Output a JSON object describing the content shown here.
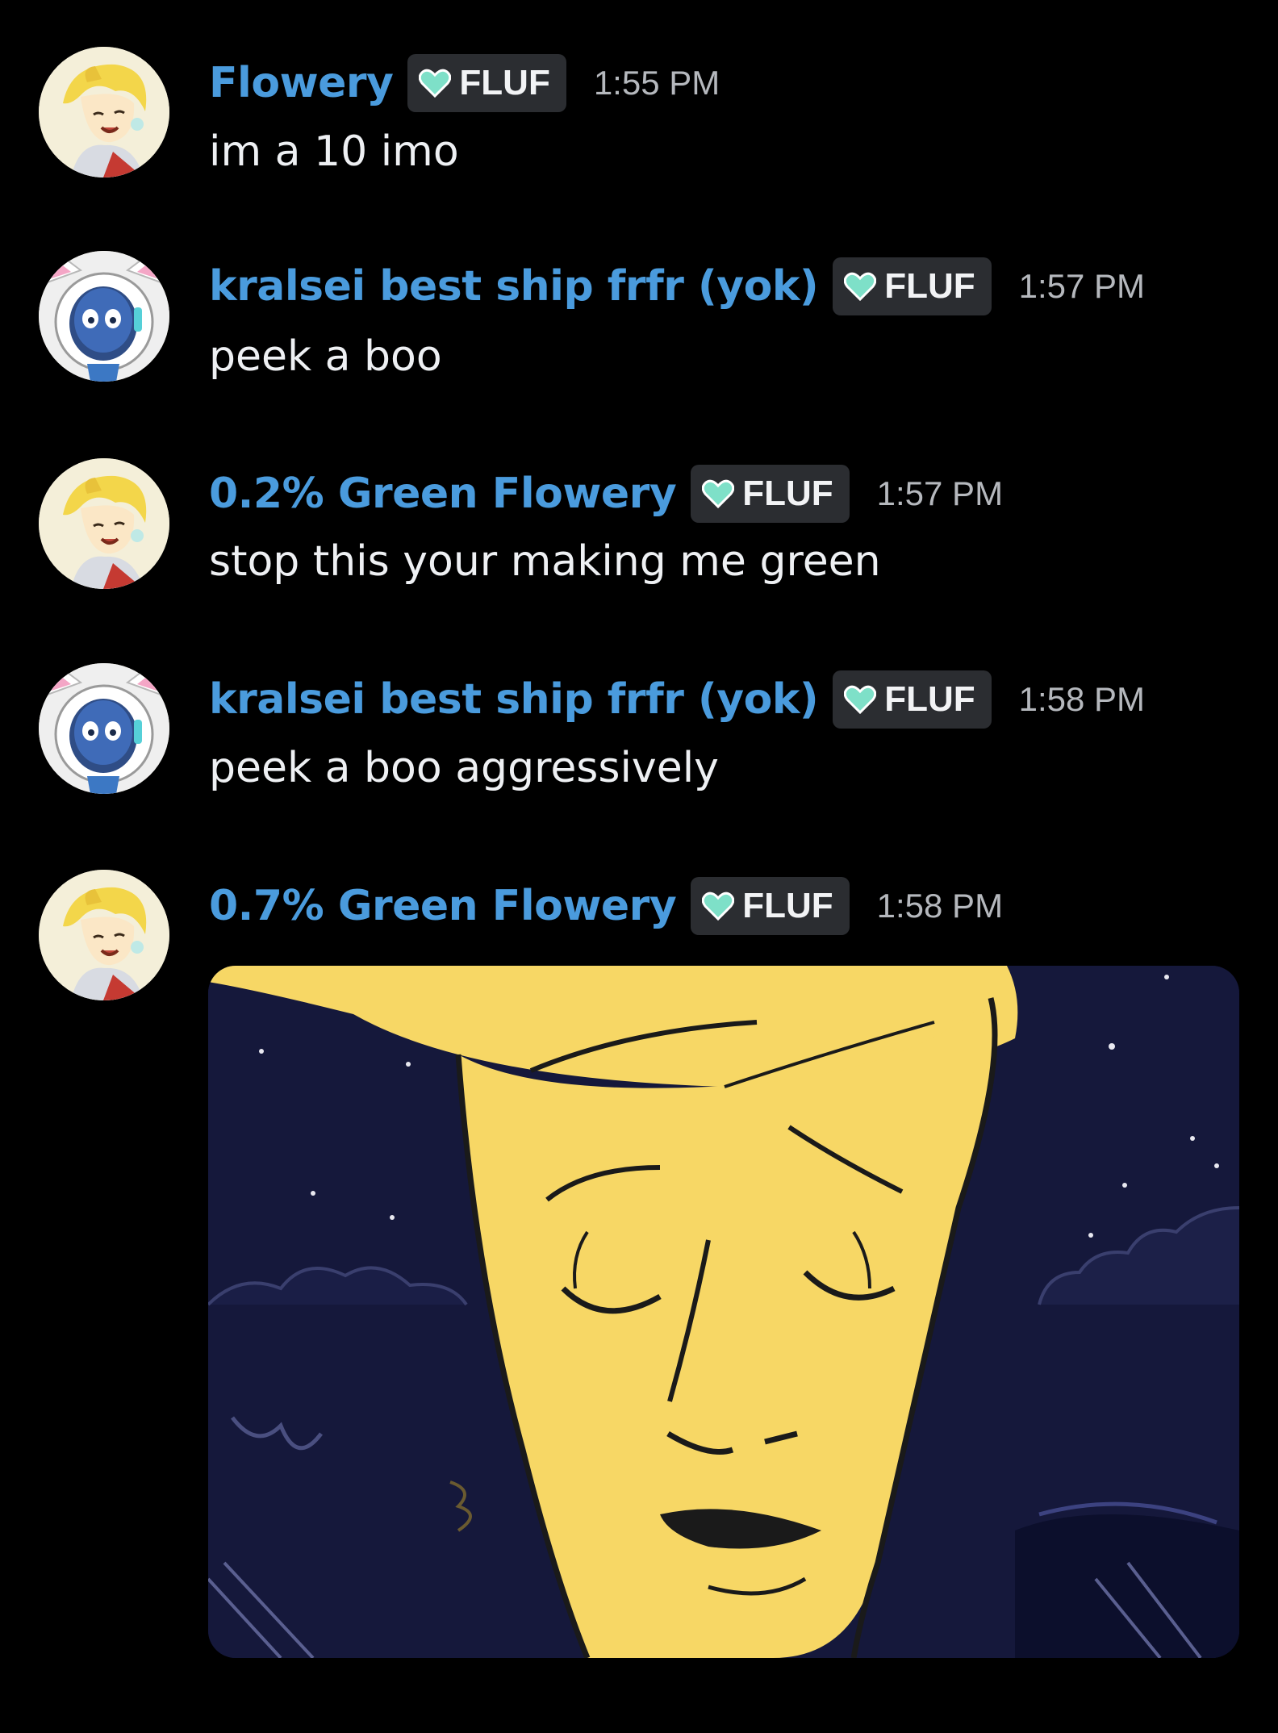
{
  "messages": [
    {
      "username": "Flowery",
      "badge": "FLUF",
      "time": "1:55 PM",
      "text": "im a 10 imo",
      "avatar_icon": "blonde-character-avatar"
    },
    {
      "username": "kralsei best ship frfr (yok)",
      "badge": "FLUF",
      "time": "1:57 PM",
      "text": "peek a boo",
      "avatar_icon": "blue-cat-astronaut-avatar"
    },
    {
      "username": "0.2% Green Flowery",
      "badge": "FLUF",
      "time": "1:57 PM",
      "text": "stop this your making me green",
      "avatar_icon": "blonde-character-avatar"
    },
    {
      "username": "kralsei best ship frfr (yok)",
      "badge": "FLUF",
      "time": "1:58 PM",
      "text": "peek a boo aggressively",
      "avatar_icon": "blue-cat-astronaut-avatar"
    },
    {
      "username": "0.7% Green Flowery",
      "badge": "FLUF",
      "time": "1:58 PM",
      "text": "",
      "avatar_icon": "blonde-character-avatar",
      "attachment": "image-yellow-face-night-sky"
    }
  ],
  "colors": {
    "background": "#000000",
    "username": "#4a9bdd",
    "badge_bg": "#2b2d31",
    "badge_heart": "#7ee0c8",
    "timestamp": "#b5b8bd",
    "message_text": "#eef0f3",
    "image_face": "#f7d765",
    "image_sky": "#14173a"
  }
}
